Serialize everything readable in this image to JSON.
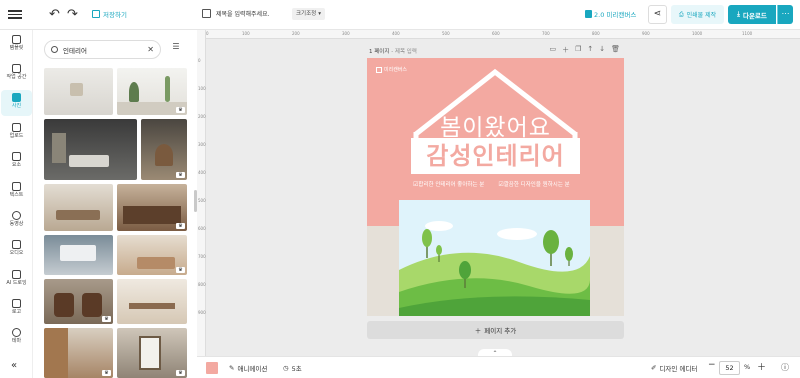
{
  "topbar": {
    "undo_icon": "undo-icon",
    "redo_icon": "redo-icon",
    "save_label": "저장하기",
    "title_placeholder": "제목을 입력해주세요.",
    "size_label": "크기조정",
    "upgrade_label": "2.0 미리캔버스",
    "print_label": "인쇄물 제작",
    "download_label": "다운로드",
    "accent": "#19a7bf"
  },
  "rail": [
    {
      "label": "템플릿"
    },
    {
      "label": "작업 공간"
    },
    {
      "label": "사진"
    },
    {
      "label": "업로드"
    },
    {
      "label": "요소"
    },
    {
      "label": "텍스트"
    },
    {
      "label": "동영상"
    },
    {
      "label": "오디오"
    },
    {
      "label": "AI 드로잉"
    },
    {
      "label": "로고"
    },
    {
      "label": "테마"
    }
  ],
  "panel": {
    "search_value": "인테리어"
  },
  "page": {
    "label": "1 페이지",
    "title_placeholder": "제목 입력"
  },
  "design": {
    "brand": "미리캔버스",
    "headline": "봄이왔어요",
    "subhead": "감성인테리어",
    "check1": "합리한 인테리어 좋아하는 분",
    "check2": "깔끔한 디자인을 원하시는 분",
    "bg_color": "#f3a9a1"
  },
  "add_page_label": "페이지 추가",
  "bottombar": {
    "animation_label": "애니메이션",
    "duration_label": "5초",
    "design_editor_label": "디자인 에디터",
    "zoom_value": "52",
    "zoom_unit": "%"
  }
}
